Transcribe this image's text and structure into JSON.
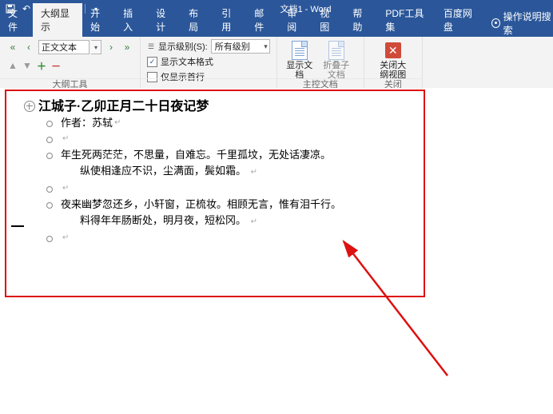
{
  "title": "文档1 - Word",
  "qat": {
    "save": "保存",
    "undo": "撤销",
    "redo": "重做",
    "start": "从头开始",
    "customize": "自定义"
  },
  "tabs": [
    "文件",
    "大纲显示",
    "开始",
    "插入",
    "设计",
    "布局",
    "引用",
    "邮件",
    "审阅",
    "视图",
    "帮助",
    "PDF工具集",
    "百度网盘"
  ],
  "active_tab_index": 1,
  "tell_me": "操作说明搜索",
  "ribbon": {
    "outline_tools_label": "大纲工具",
    "body_text": "正文文本",
    "show_level_label": "显示级别(S):",
    "show_level_value": "所有级别",
    "show_text_formatting": "显示文本格式",
    "show_first_line_only": "仅显示首行",
    "master_doc_label": "主控文档",
    "show_document": "显示文档",
    "collapse_subdocs": "折叠子文档",
    "close_label": "关闭",
    "close_outline": "关闭大纲视图"
  },
  "document": {
    "heading": "江城子·乙卯正月二十日夜记梦",
    "author_line": "作者：苏轼",
    "stanza1_line1": "年生死两茫茫，不思量，自难忘。千里孤坟，无处话凄凉。",
    "stanza1_line2": "纵使相逢应不识，尘满面，鬓如霜。",
    "stanza2_line1": "夜来幽梦忽还乡，小轩窗，正梳妆。相顾无言，惟有泪千行。",
    "stanza2_line2": "料得年年肠断处，明月夜，短松冈。",
    "return_mark": "↵"
  }
}
